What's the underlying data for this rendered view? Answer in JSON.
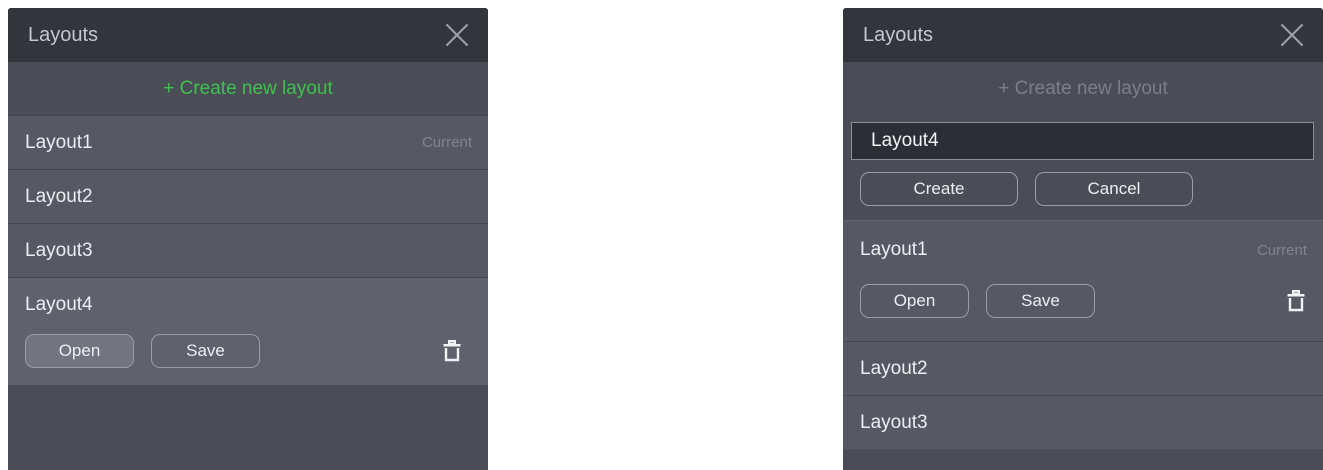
{
  "left": {
    "title": "Layouts",
    "create_label": "+ Create new layout",
    "items": [
      {
        "name": "Layout1",
        "status": "Current"
      },
      {
        "name": "Layout2",
        "status": ""
      },
      {
        "name": "Layout3",
        "status": ""
      },
      {
        "name": "Layout4",
        "status": ""
      }
    ],
    "open_label": "Open",
    "save_label": "Save"
  },
  "right": {
    "title": "Layouts",
    "create_label": "+ Create new layout",
    "input_value": "Layout4",
    "create_button": "Create",
    "cancel_button": "Cancel",
    "items": [
      {
        "name": "Layout1",
        "status": "Current"
      },
      {
        "name": "Layout2",
        "status": ""
      },
      {
        "name": "Layout3",
        "status": ""
      }
    ],
    "open_label": "Open",
    "save_label": "Save"
  },
  "colors": {
    "accent_green": "#3cc24d",
    "titlebar": "#33353d",
    "panel": "#4a4c56",
    "item": "#565864"
  }
}
